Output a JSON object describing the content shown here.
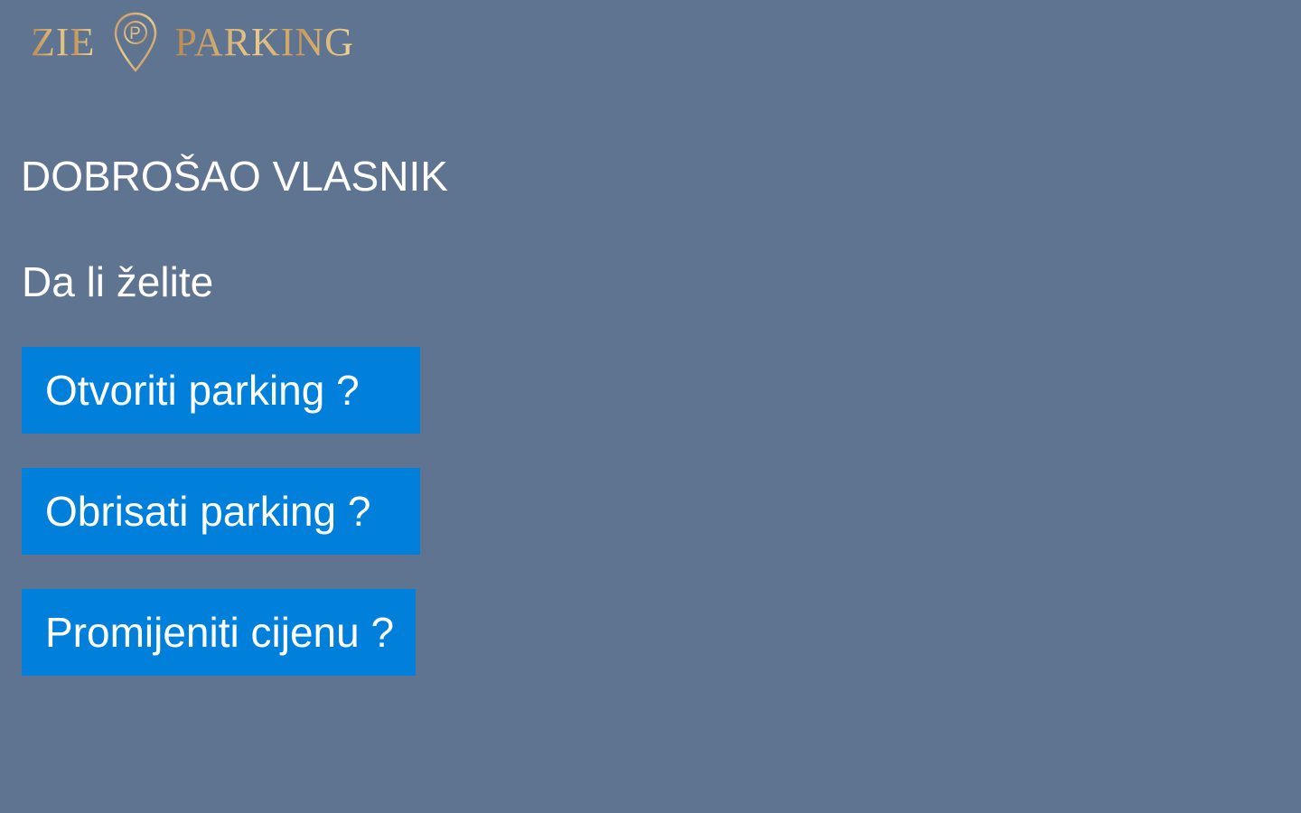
{
  "logo": {
    "left_word": "ZIE",
    "pin_letter": "P",
    "right_word": "PARKING"
  },
  "welcome_title": "DOBROŠAO VLASNIK",
  "question": "Da li želite",
  "actions": [
    {
      "label": "Otvoriti parking ?"
    },
    {
      "label": "Obrisati parking ?"
    },
    {
      "label": "Promijeniti cijenu ?"
    }
  ],
  "colors": {
    "background": "#5f7490",
    "button": "#0080db",
    "button_text": "#ffffff",
    "logo_gold": "#d6ad6b"
  }
}
